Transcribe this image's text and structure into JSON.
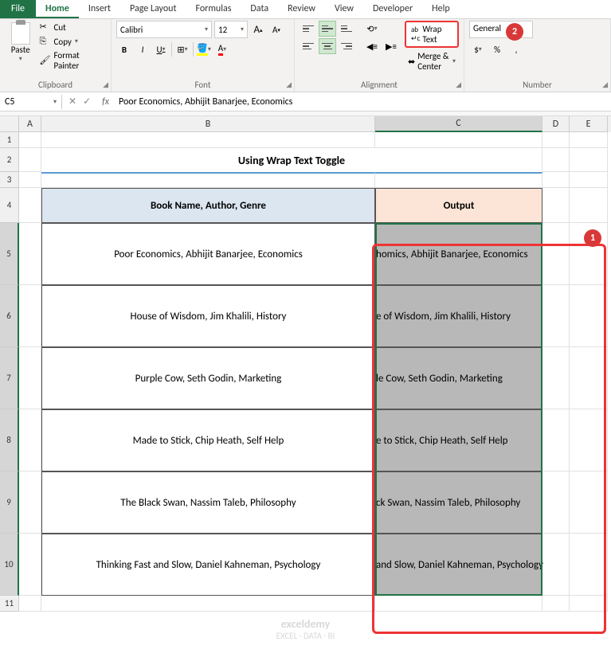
{
  "tabs": {
    "file": "File",
    "home": "Home",
    "insert": "Insert",
    "page_layout": "Page Layout",
    "formulas": "Formulas",
    "data": "Data",
    "review": "Review",
    "view": "View",
    "developer": "Developer",
    "help": "Help"
  },
  "ribbon": {
    "clipboard": {
      "label": "Clipboard",
      "paste": "Paste",
      "cut": "Cut",
      "copy": "Copy",
      "format_painter": "Format Painter"
    },
    "font": {
      "label": "Font",
      "name": "Calibri",
      "size": "12",
      "bold": "B",
      "italic": "I",
      "underline": "U",
      "increase": "A",
      "decrease": "A"
    },
    "alignment": {
      "label": "Alignment",
      "wrap_text": "Wrap Text",
      "merge_center": "Merge & Center"
    },
    "number": {
      "label": "Number",
      "format": "General"
    }
  },
  "formula_bar": {
    "name_box": "C5",
    "formula": "Poor Economics, Abhijit Banarjee, Economics"
  },
  "columns": [
    "A",
    "B",
    "C",
    "D",
    "E"
  ],
  "row_labels": [
    "1",
    "2",
    "3",
    "4",
    "5",
    "6",
    "7",
    "8",
    "9",
    "10",
    "11"
  ],
  "sheet": {
    "title": "Using Wrap Text Toggle",
    "header_b": "Book Name, Author, Genre",
    "header_c": "Output",
    "rows": [
      {
        "b": "Poor Economics, Abhijit Banarjee, Economics",
        "c_visible": "homics, Abhijit Banarjee, Economics"
      },
      {
        "b": "House of Wisdom, Jim Khalili, History",
        "c_visible": "e of Wisdom, Jim Khalili, History"
      },
      {
        "b": "Purple Cow, Seth Godin, Marketing",
        "c_visible": "le Cow, Seth Godin, Marketing"
      },
      {
        "b": "Made to Stick, Chip Heath, Self Help",
        "c_visible": "e to Stick, Chip Heath, Self Help"
      },
      {
        "b": "The Black Swan, Nassim Taleb, Philosophy",
        "c_visible": "ck Swan, Nassim Taleb, Philosophy"
      },
      {
        "b": "Thinking Fast and Slow, Daniel Kahneman, Psychology",
        "c_visible": "and Slow, Daniel Kahneman, Psychology"
      }
    ]
  },
  "badges": {
    "b1": "1",
    "b2": "2"
  },
  "watermark": {
    "title": "exceldemy",
    "sub": "EXCEL · DATA · BI"
  }
}
